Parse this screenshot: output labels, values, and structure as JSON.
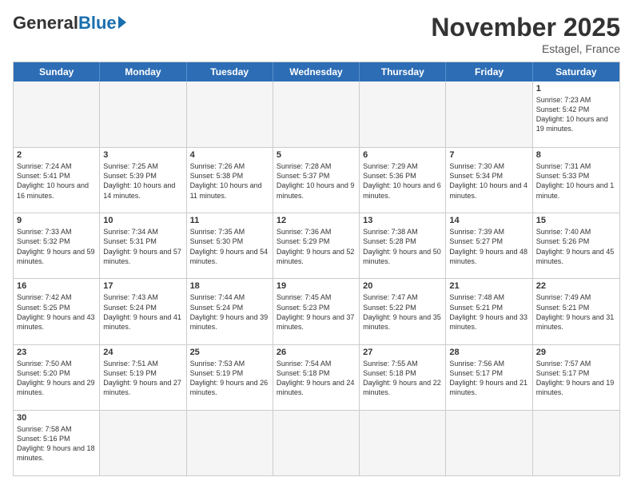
{
  "header": {
    "logo_general": "General",
    "logo_blue": "Blue",
    "month_title": "November 2025",
    "location": "Estagel, France"
  },
  "calendar": {
    "days_of_week": [
      "Sunday",
      "Monday",
      "Tuesday",
      "Wednesday",
      "Thursday",
      "Friday",
      "Saturday"
    ],
    "weeks": [
      [
        {
          "day": "",
          "info": "",
          "empty": true
        },
        {
          "day": "",
          "info": "",
          "empty": true
        },
        {
          "day": "",
          "info": "",
          "empty": true
        },
        {
          "day": "",
          "info": "",
          "empty": true
        },
        {
          "day": "",
          "info": "",
          "empty": true
        },
        {
          "day": "",
          "info": "",
          "empty": true
        },
        {
          "day": "1",
          "info": "Sunrise: 7:23 AM\nSunset: 5:42 PM\nDaylight: 10 hours and 19 minutes.",
          "empty": false
        }
      ],
      [
        {
          "day": "2",
          "info": "Sunrise: 7:24 AM\nSunset: 5:41 PM\nDaylight: 10 hours and 16 minutes.",
          "empty": false
        },
        {
          "day": "3",
          "info": "Sunrise: 7:25 AM\nSunset: 5:39 PM\nDaylight: 10 hours and 14 minutes.",
          "empty": false
        },
        {
          "day": "4",
          "info": "Sunrise: 7:26 AM\nSunset: 5:38 PM\nDaylight: 10 hours and 11 minutes.",
          "empty": false
        },
        {
          "day": "5",
          "info": "Sunrise: 7:28 AM\nSunset: 5:37 PM\nDaylight: 10 hours and 9 minutes.",
          "empty": false
        },
        {
          "day": "6",
          "info": "Sunrise: 7:29 AM\nSunset: 5:36 PM\nDaylight: 10 hours and 6 minutes.",
          "empty": false
        },
        {
          "day": "7",
          "info": "Sunrise: 7:30 AM\nSunset: 5:34 PM\nDaylight: 10 hours and 4 minutes.",
          "empty": false
        },
        {
          "day": "8",
          "info": "Sunrise: 7:31 AM\nSunset: 5:33 PM\nDaylight: 10 hours and 1 minute.",
          "empty": false
        }
      ],
      [
        {
          "day": "9",
          "info": "Sunrise: 7:33 AM\nSunset: 5:32 PM\nDaylight: 9 hours and 59 minutes.",
          "empty": false
        },
        {
          "day": "10",
          "info": "Sunrise: 7:34 AM\nSunset: 5:31 PM\nDaylight: 9 hours and 57 minutes.",
          "empty": false
        },
        {
          "day": "11",
          "info": "Sunrise: 7:35 AM\nSunset: 5:30 PM\nDaylight: 9 hours and 54 minutes.",
          "empty": false
        },
        {
          "day": "12",
          "info": "Sunrise: 7:36 AM\nSunset: 5:29 PM\nDaylight: 9 hours and 52 minutes.",
          "empty": false
        },
        {
          "day": "13",
          "info": "Sunrise: 7:38 AM\nSunset: 5:28 PM\nDaylight: 9 hours and 50 minutes.",
          "empty": false
        },
        {
          "day": "14",
          "info": "Sunrise: 7:39 AM\nSunset: 5:27 PM\nDaylight: 9 hours and 48 minutes.",
          "empty": false
        },
        {
          "day": "15",
          "info": "Sunrise: 7:40 AM\nSunset: 5:26 PM\nDaylight: 9 hours and 45 minutes.",
          "empty": false
        }
      ],
      [
        {
          "day": "16",
          "info": "Sunrise: 7:42 AM\nSunset: 5:25 PM\nDaylight: 9 hours and 43 minutes.",
          "empty": false
        },
        {
          "day": "17",
          "info": "Sunrise: 7:43 AM\nSunset: 5:24 PM\nDaylight: 9 hours and 41 minutes.",
          "empty": false
        },
        {
          "day": "18",
          "info": "Sunrise: 7:44 AM\nSunset: 5:24 PM\nDaylight: 9 hours and 39 minutes.",
          "empty": false
        },
        {
          "day": "19",
          "info": "Sunrise: 7:45 AM\nSunset: 5:23 PM\nDaylight: 9 hours and 37 minutes.",
          "empty": false
        },
        {
          "day": "20",
          "info": "Sunrise: 7:47 AM\nSunset: 5:22 PM\nDaylight: 9 hours and 35 minutes.",
          "empty": false
        },
        {
          "day": "21",
          "info": "Sunrise: 7:48 AM\nSunset: 5:21 PM\nDaylight: 9 hours and 33 minutes.",
          "empty": false
        },
        {
          "day": "22",
          "info": "Sunrise: 7:49 AM\nSunset: 5:21 PM\nDaylight: 9 hours and 31 minutes.",
          "empty": false
        }
      ],
      [
        {
          "day": "23",
          "info": "Sunrise: 7:50 AM\nSunset: 5:20 PM\nDaylight: 9 hours and 29 minutes.",
          "empty": false
        },
        {
          "day": "24",
          "info": "Sunrise: 7:51 AM\nSunset: 5:19 PM\nDaylight: 9 hours and 27 minutes.",
          "empty": false
        },
        {
          "day": "25",
          "info": "Sunrise: 7:53 AM\nSunset: 5:19 PM\nDaylight: 9 hours and 26 minutes.",
          "empty": false
        },
        {
          "day": "26",
          "info": "Sunrise: 7:54 AM\nSunset: 5:18 PM\nDaylight: 9 hours and 24 minutes.",
          "empty": false
        },
        {
          "day": "27",
          "info": "Sunrise: 7:55 AM\nSunset: 5:18 PM\nDaylight: 9 hours and 22 minutes.",
          "empty": false
        },
        {
          "day": "28",
          "info": "Sunrise: 7:56 AM\nSunset: 5:17 PM\nDaylight: 9 hours and 21 minutes.",
          "empty": false
        },
        {
          "day": "29",
          "info": "Sunrise: 7:57 AM\nSunset: 5:17 PM\nDaylight: 9 hours and 19 minutes.",
          "empty": false
        }
      ],
      [
        {
          "day": "30",
          "info": "Sunrise: 7:58 AM\nSunset: 5:16 PM\nDaylight: 9 hours and 18 minutes.",
          "empty": false
        },
        {
          "day": "",
          "info": "",
          "empty": true
        },
        {
          "day": "",
          "info": "",
          "empty": true
        },
        {
          "day": "",
          "info": "",
          "empty": true
        },
        {
          "day": "",
          "info": "",
          "empty": true
        },
        {
          "day": "",
          "info": "",
          "empty": true
        },
        {
          "day": "",
          "info": "",
          "empty": true
        }
      ]
    ]
  }
}
